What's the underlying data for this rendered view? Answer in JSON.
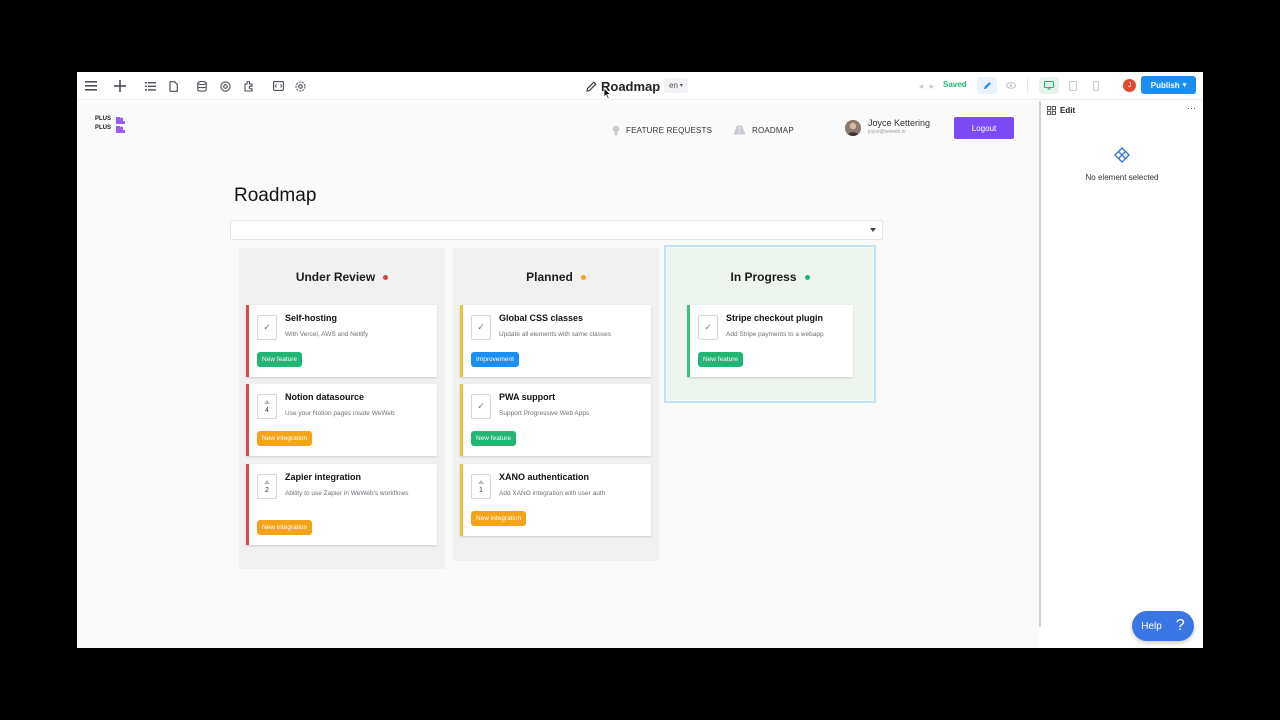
{
  "toolbar": {
    "title": "Roadmap",
    "lang": "en",
    "saved_label": "Saved",
    "publish_label": "Publish",
    "user_initial": "J",
    "icons": [
      "menu-icon",
      "add-icon",
      "list-icon",
      "page-icon",
      "database-icon",
      "at-icon",
      "plugin-icon",
      "code-icon",
      "settings-icon"
    ]
  },
  "site": {
    "logo_line1": "PLUS",
    "logo_line2": "PLUS",
    "nav": {
      "feature_requests": "FEATURE REQUESTS",
      "roadmap": "ROADMAP"
    },
    "user": {
      "name": "Joyce Kettering",
      "email": "joyce@weweb.io"
    },
    "logout_label": "Logout",
    "page_title": "Roadmap"
  },
  "columns": [
    {
      "title": "Under Review",
      "dot_color": "#e0433b",
      "cards": [
        {
          "title": "Self-hosting",
          "desc": "With Vercel, AWS and Netlify",
          "vote": "",
          "tag": "New feature",
          "tag_color": "#22b573",
          "border": "#d84c4c"
        },
        {
          "title": "Notion datasource",
          "desc": "Use your Notion pages inside WeWeb",
          "vote": "4",
          "tag": "New integration",
          "tag_color": "#f5a31a",
          "border": "#d84c4c"
        },
        {
          "title": "Zapier integration",
          "desc": "Ability to use Zapier in WeWeb's workflows",
          "vote": "2",
          "tag": "New integration",
          "tag_color": "#f5a31a",
          "border": "#d84c4c"
        }
      ]
    },
    {
      "title": "Planned",
      "dot_color": "#f5a31a",
      "cards": [
        {
          "title": "Global CSS classes",
          "desc": "Update all elements with same classes",
          "vote": "",
          "tag": "Improvement",
          "tag_color": "#1b8ef2",
          "border": "#f0c042"
        },
        {
          "title": "PWA support",
          "desc": "Support Progressive Web Apps",
          "vote": "",
          "tag": "New feature",
          "tag_color": "#22b573",
          "border": "#f0c042"
        },
        {
          "title": "XANO authentication",
          "desc": "Add XANO integration with user auth",
          "vote": "1",
          "tag": "New integration",
          "tag_color": "#f5a31a",
          "border": "#f0c042"
        }
      ]
    },
    {
      "title": "In Progress",
      "dot_color": "#22b573",
      "cards": [
        {
          "title": "Stripe checkout plugin",
          "desc": "Add Stripe payments to a webapp",
          "vote": "",
          "tag": "New feature",
          "tag_color": "#22b573",
          "border": "#3cc47c"
        }
      ]
    }
  ],
  "panel": {
    "title": "Edit",
    "empty_text": "No element selected"
  },
  "help_label": "Help"
}
